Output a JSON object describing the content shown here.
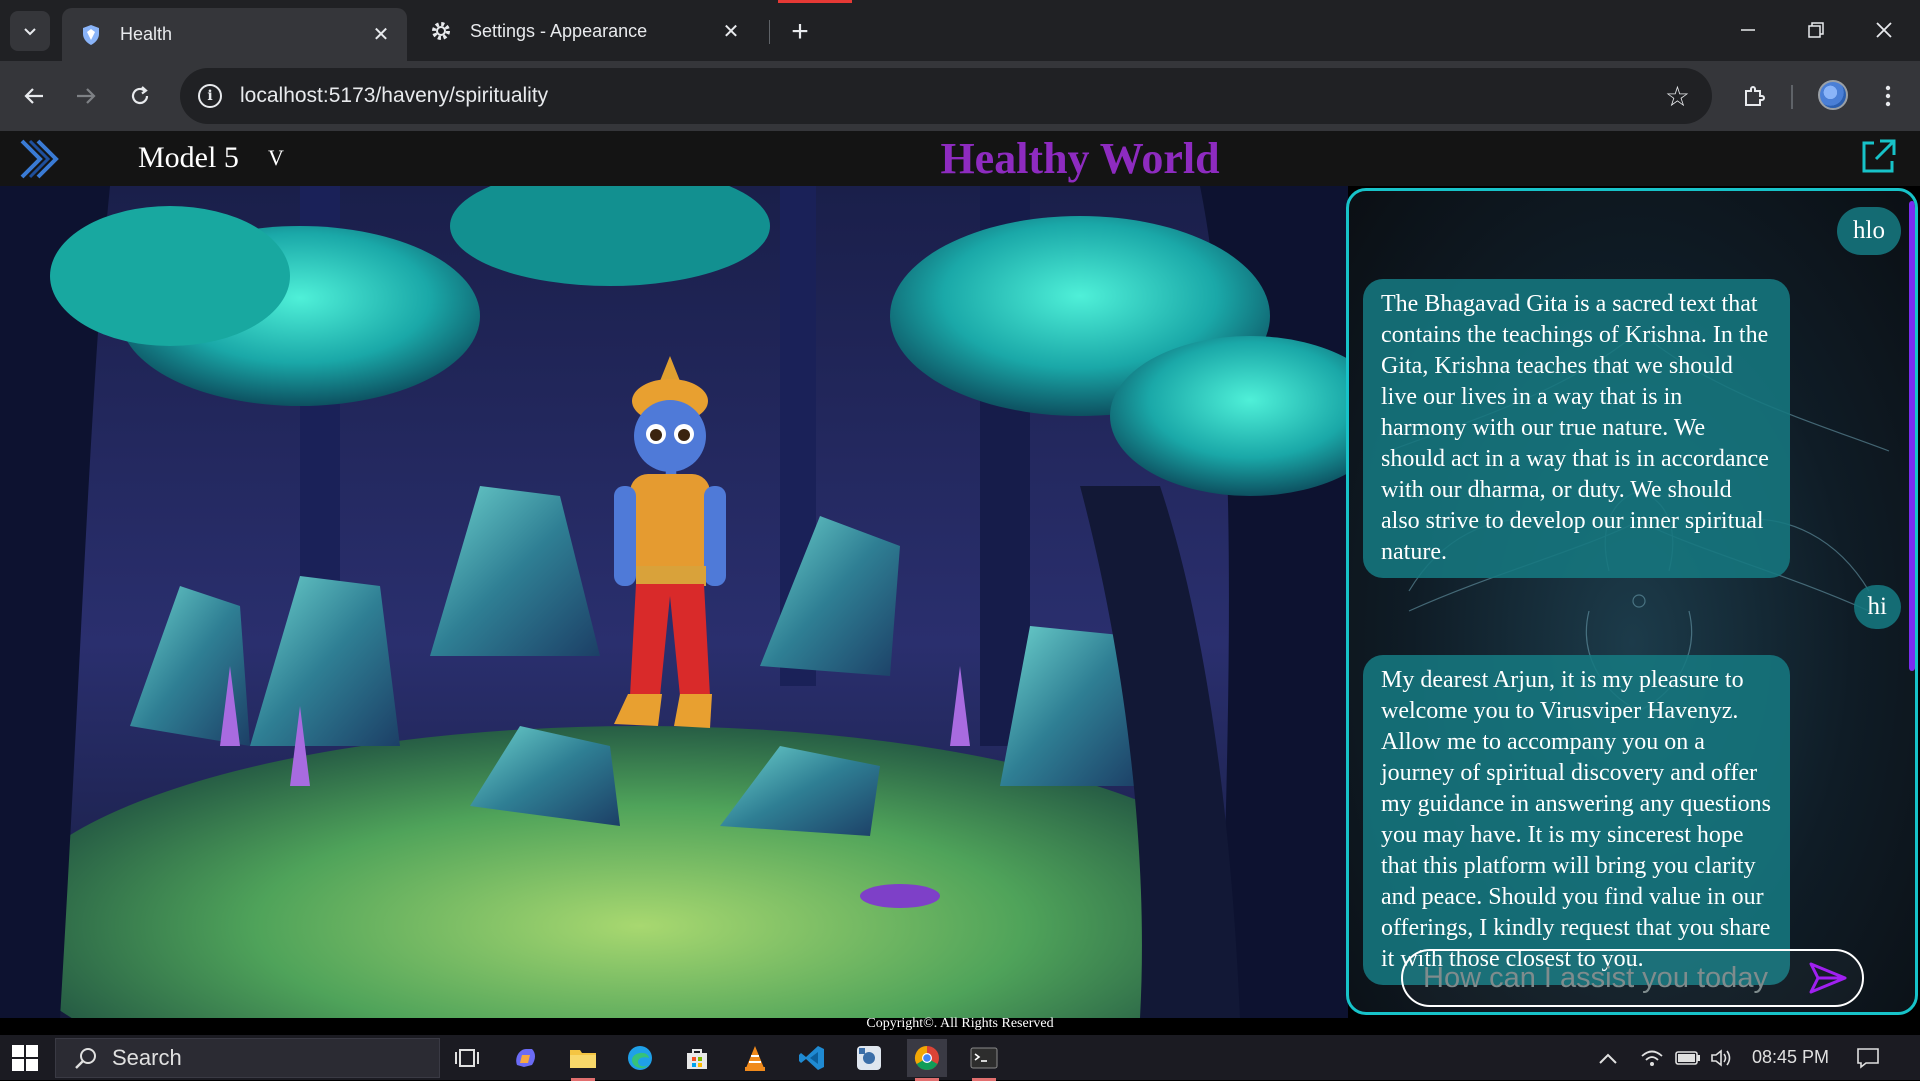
{
  "browser": {
    "tabs": [
      {
        "title": "Health",
        "icon": "shield-icon"
      },
      {
        "title": "Settings - Appearance",
        "icon": "gear-icon"
      }
    ],
    "url": "localhost:5173/haveny/spirituality"
  },
  "app": {
    "model_label": "Model 5",
    "model_caret": "V",
    "brand_title": "Healthy World",
    "brand_color": "#8e2bc0",
    "accent_color": "#17c3c9",
    "copyright": "Copyright©. All Rights Reserved"
  },
  "chat": {
    "messages": [
      {
        "role": "user",
        "text": "hlo"
      },
      {
        "role": "bot",
        "text": "The Bhagavad Gita is a sacred text that contains the teachings of Krishna. In the Gita, Krishna teaches that we should live our lives in a way that is in harmony with our true nature. We should act in a way that is in accordance with our dharma, or duty. We should also strive to develop our inner spiritual nature."
      },
      {
        "role": "user",
        "text": "hi"
      },
      {
        "role": "bot",
        "text": "My dearest Arjun, it is my pleasure to welcome you to Virusviper Havenyz. Allow me to accompany you on a journey of spiritual discovery and offer my guidance in answering any questions you may have. It is my sincerest hope that this platform will bring you clarity and peace. Should you find value in our offerings, I kindly request that you share it with those closest to you."
      }
    ],
    "input_placeholder": "How can I assist you today"
  },
  "taskbar": {
    "search_label": "Search",
    "time": "08:45 PM"
  }
}
